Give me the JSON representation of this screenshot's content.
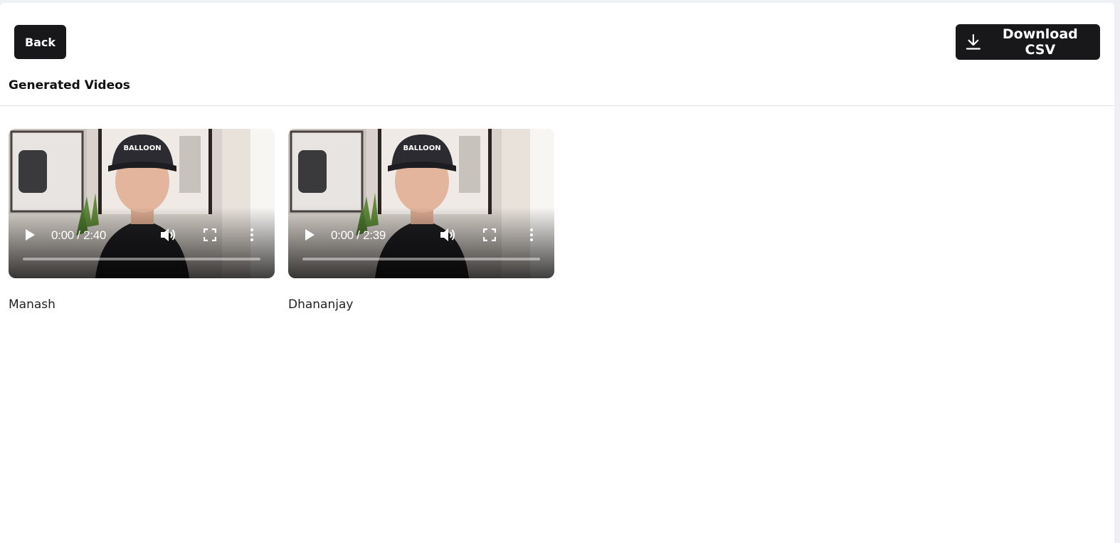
{
  "header": {
    "back_label": "Back",
    "download_label": "Download CSV",
    "download_icon": "download-icon"
  },
  "section": {
    "title": "Generated Videos"
  },
  "videos": [
    {
      "name": "Manash",
      "time": "0:00 / 2:40",
      "progress": 0,
      "cap_text": "BALLOON"
    },
    {
      "name": "Dhananjay",
      "time": "0:00 / 2:39",
      "progress": 0,
      "cap_text": "BALLOON"
    }
  ],
  "icons": {
    "play": "play-icon",
    "volume": "volume-icon",
    "fullscreen": "fullscreen-icon",
    "more": "more-vertical-icon"
  },
  "colors": {
    "button_bg": "#18181b",
    "button_text": "#ffffff",
    "divider": "#e2e2e6"
  }
}
